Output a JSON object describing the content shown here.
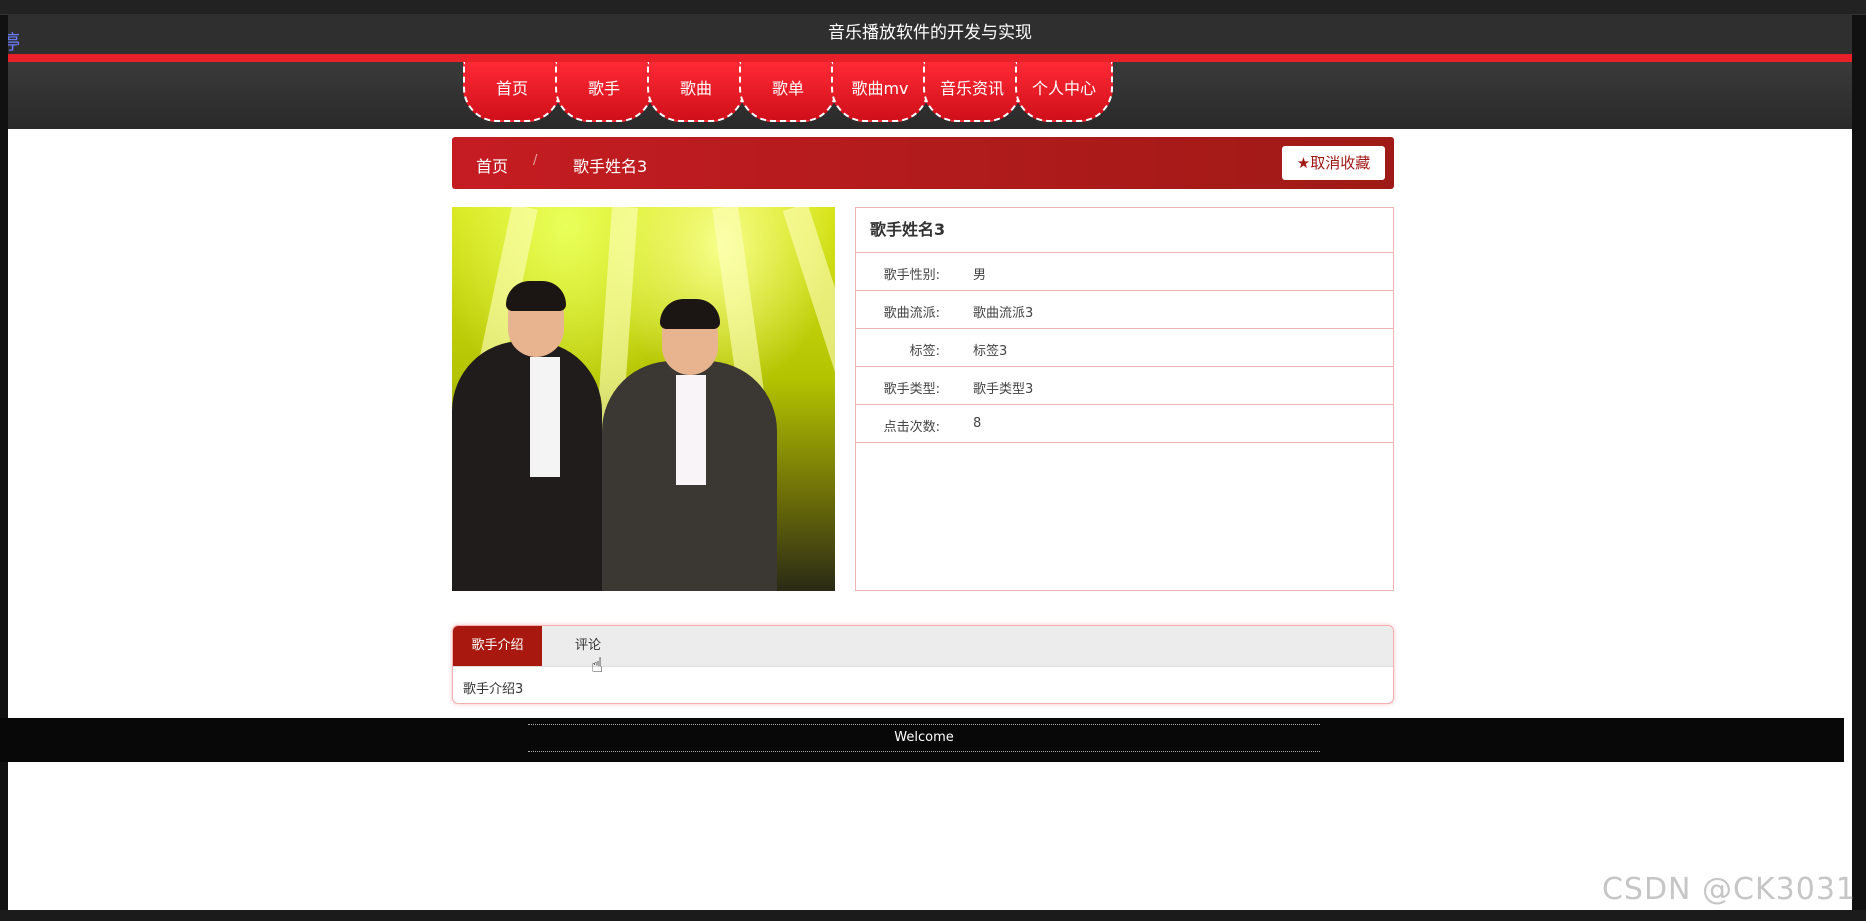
{
  "marquee_text": "停",
  "site_title": "音乐播放软件的开发与实现",
  "nav": [
    "首页",
    "歌手",
    "歌曲",
    "歌单",
    "歌曲mv",
    "音乐资讯",
    "个人中心"
  ],
  "breadcrumb": {
    "home": "首页",
    "separator": "/",
    "current": "歌手姓名3"
  },
  "favorite_button": "取消收藏",
  "detail": {
    "name": "歌手姓名3",
    "rows": [
      {
        "label": "歌手性别:",
        "value": "男"
      },
      {
        "label": "歌曲流派:",
        "value": "歌曲流派3"
      },
      {
        "label": "标签:",
        "value": "标签3"
      },
      {
        "label": "歌手类型:",
        "value": "歌手类型3"
      },
      {
        "label": "点击次数:",
        "value": "8"
      }
    ]
  },
  "tabs": {
    "active": "歌手介绍",
    "other": "评论",
    "content": "歌手介绍3"
  },
  "footer_text": "Welcome",
  "watermark": "CSDN @CK3031",
  "colors": {
    "accent": "#e8202a",
    "dark_red": "#a8180f"
  }
}
